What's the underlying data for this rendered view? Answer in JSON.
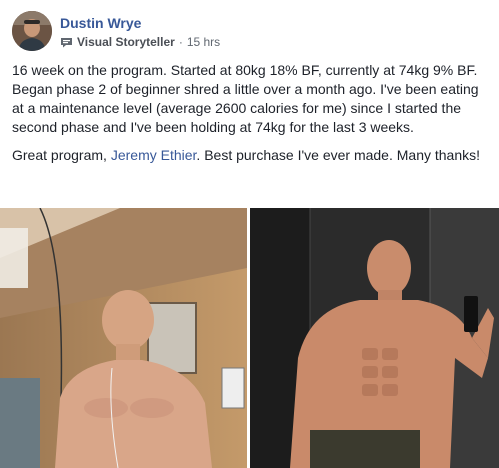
{
  "post": {
    "author": "Dustin Wrye",
    "role": "Visual Storyteller",
    "separator": "·",
    "time": "15 hrs",
    "paragraph1": "16 week on the program. Started at 80kg 18% BF, currently at 74kg 9% BF. Began phase 2 of beginner shred a little over a month ago. I've been eating at a maintenance level (average 2600 calories for me) since I started the second phase and I've been holding at 74kg for the last 3 weeks.",
    "paragraph2_before": "Great program, ",
    "mention": "Jeremy Ethier",
    "paragraph2_after": ". Best purchase I've ever made. Many thanks!"
  },
  "icons": {
    "badge": "storyteller-badge-icon"
  },
  "colors": {
    "link": "#385898",
    "text": "#1d2129",
    "meta": "#606770"
  }
}
